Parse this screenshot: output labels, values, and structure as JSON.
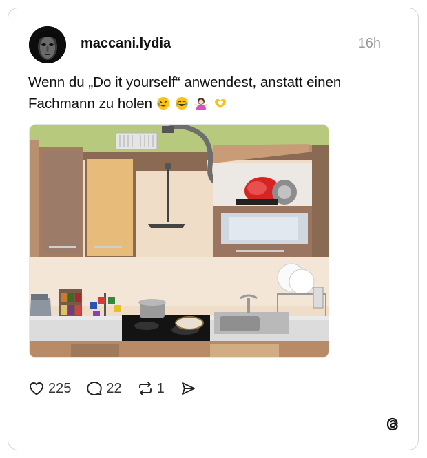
{
  "post": {
    "username": "maccani.lydia",
    "time": "16h",
    "text": "Wenn du „Do it yourself“ anwendest, anstatt einen Fachmann zu holen",
    "emojis": [
      "rofl-emoji",
      "joy-emoji",
      "woman-shrugging-emoji",
      "heart-hands-emoji"
    ]
  },
  "actions": {
    "likes": "225",
    "comments": "22",
    "reposts": "1"
  },
  "colors": {
    "text": "#111111",
    "muted": "#999999",
    "border": "#d4d4d4"
  }
}
